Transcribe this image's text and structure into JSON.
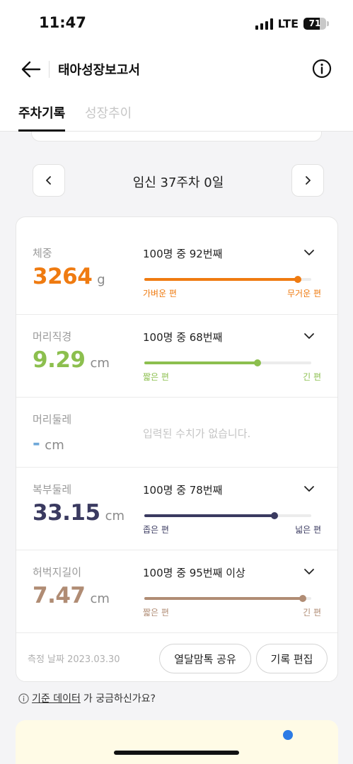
{
  "status_bar": {
    "time": "11:47",
    "network": "LTE",
    "battery": "71",
    "battery_fraction": 0.71
  },
  "header": {
    "title": "태아성장보고서"
  },
  "tabs": [
    {
      "label": "주차기록",
      "active": true
    },
    {
      "label": "성장추이",
      "active": false
    }
  ],
  "week_nav": {
    "label": "임신 37주차 0일"
  },
  "measurements": [
    {
      "label": "체중",
      "value": "3264",
      "unit": "g",
      "rank": "100명 중 92번째",
      "percentile": 0.92,
      "low_label": "가벼운 편",
      "high_label": "무거운 편",
      "color": "#ef7b11"
    },
    {
      "label": "머리직경",
      "value": "9.29",
      "unit": "cm",
      "rank": "100명 중 68번째",
      "percentile": 0.68,
      "low_label": "짧은 편",
      "high_label": "긴 편",
      "color": "#8cbf4e"
    },
    {
      "label": "머리둘레",
      "value": "-",
      "unit": "cm",
      "empty_message": "입력된 수치가 없습니다.",
      "color": "#6ea8d8"
    },
    {
      "label": "복부둘레",
      "value": "33.15",
      "unit": "cm",
      "rank": "100명 중 78번째",
      "percentile": 0.78,
      "low_label": "좁은 편",
      "high_label": "넓은 편",
      "color": "#3a3a60"
    },
    {
      "label": "허벅지길이",
      "value": "7.47",
      "unit": "cm",
      "rank": "100명 중 95번째 이상",
      "percentile": 0.95,
      "low_label": "짧은 편",
      "high_label": "긴 편",
      "color": "#b08c74"
    }
  ],
  "footer": {
    "measure_date": "측정 날짜 2023.03.30",
    "share_label": "열달맘톡 공유",
    "edit_label": "기록 편집"
  },
  "help": {
    "link_text": "기준 데이터",
    "rest_text": "가 궁금하신가요?"
  }
}
